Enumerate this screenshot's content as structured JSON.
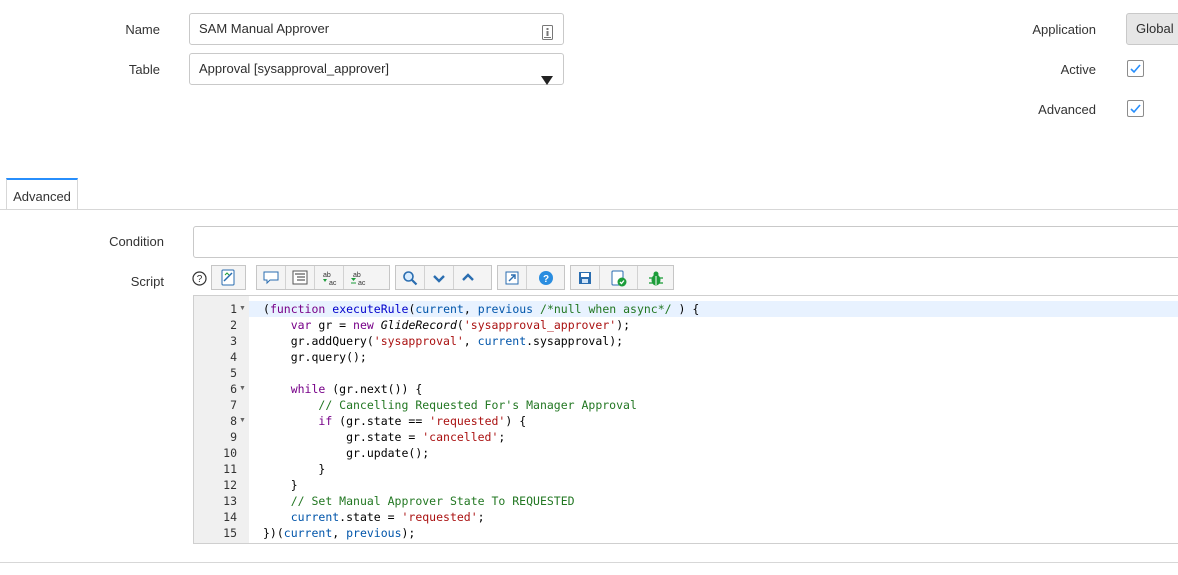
{
  "form": {
    "name_label": "Name",
    "name_value": "SAM Manual Approver",
    "table_label": "Table",
    "table_value": "Approval [sysapproval_approver]",
    "application_label": "Application",
    "application_value": "Global",
    "active_label": "Active",
    "active_checked": true,
    "advanced_label": "Advanced",
    "advanced_checked": true
  },
  "tabs": [
    {
      "label": "Advanced",
      "selected": true
    }
  ],
  "advanced": {
    "condition_label": "Condition",
    "condition_value": "",
    "script_label": "Script"
  },
  "toolbar": {
    "icons": [
      "help-icon",
      "toggle-syntax-icon",
      "comment-icon",
      "format-icon",
      "replace-icon",
      "replace-all-icon",
      "search-icon",
      "find-next-icon",
      "find-previous-icon",
      "fullscreen-icon",
      "script-help-icon",
      "save-icon",
      "syntax-check-icon",
      "debugger-icon"
    ]
  },
  "script": {
    "line_numbers": [
      "1",
      "2",
      "3",
      "4",
      "5",
      "6",
      "7",
      "8",
      "9",
      "10",
      "11",
      "12",
      "13",
      "14",
      "15"
    ],
    "lines": [
      "(function executeRule(current, previous /*null when async*/ ) {",
      "    var gr = new GlideRecord('sysapproval_approver');",
      "    gr.addQuery('sysapproval', current.sysapproval);",
      "    gr.query();",
      "",
      "    while (gr.next()) {",
      "        // Cancelling Requested For's Manager Approval",
      "        if (gr.state == 'requested') {",
      "            gr.state = 'cancelled';",
      "            gr.update();",
      "        }",
      "    }",
      "    // Set Manual Approver State To REQUESTED",
      "    current.state = 'requested';",
      "})(current, previous);"
    ],
    "foldable_lines": [
      1,
      6,
      8
    ]
  },
  "colors": {
    "accent": "#278efc",
    "keyword": "#770088",
    "string": "#aa1111",
    "comment": "#227722"
  }
}
